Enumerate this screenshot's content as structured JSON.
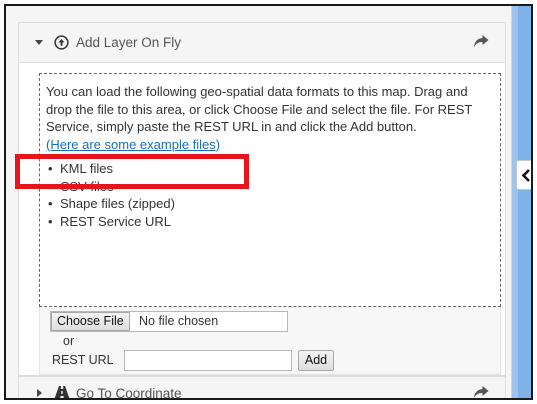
{
  "add_layer_panel": {
    "title": "Add Layer On Fly",
    "description": "You can load the following geo-spatial data formats to this map. Drag and drop the file to this area, or click Choose File and select the file. For REST Service, simply paste the REST URL in and click the Add button.",
    "example_link": "(Here are some example files)",
    "formats": [
      "KML files",
      "CSV files",
      "Shape files (zipped)",
      "REST Service URL"
    ],
    "choose_file_label": "Choose File",
    "no_file_text": "No file chosen",
    "or_text": "or",
    "rest_url_label": "REST URL",
    "rest_url_value": "",
    "add_button_label": "Add"
  },
  "goto_panel": {
    "title": "Go To Coordinate"
  },
  "colors": {
    "highlight": "#e8141c",
    "link": "#1a6fb6",
    "map": "#7fb2e6"
  },
  "icons": {
    "add_layer": "upload-circle-icon",
    "share": "share-arrow-icon",
    "goto": "road-icon",
    "collapse": "chevron-left-icon"
  }
}
